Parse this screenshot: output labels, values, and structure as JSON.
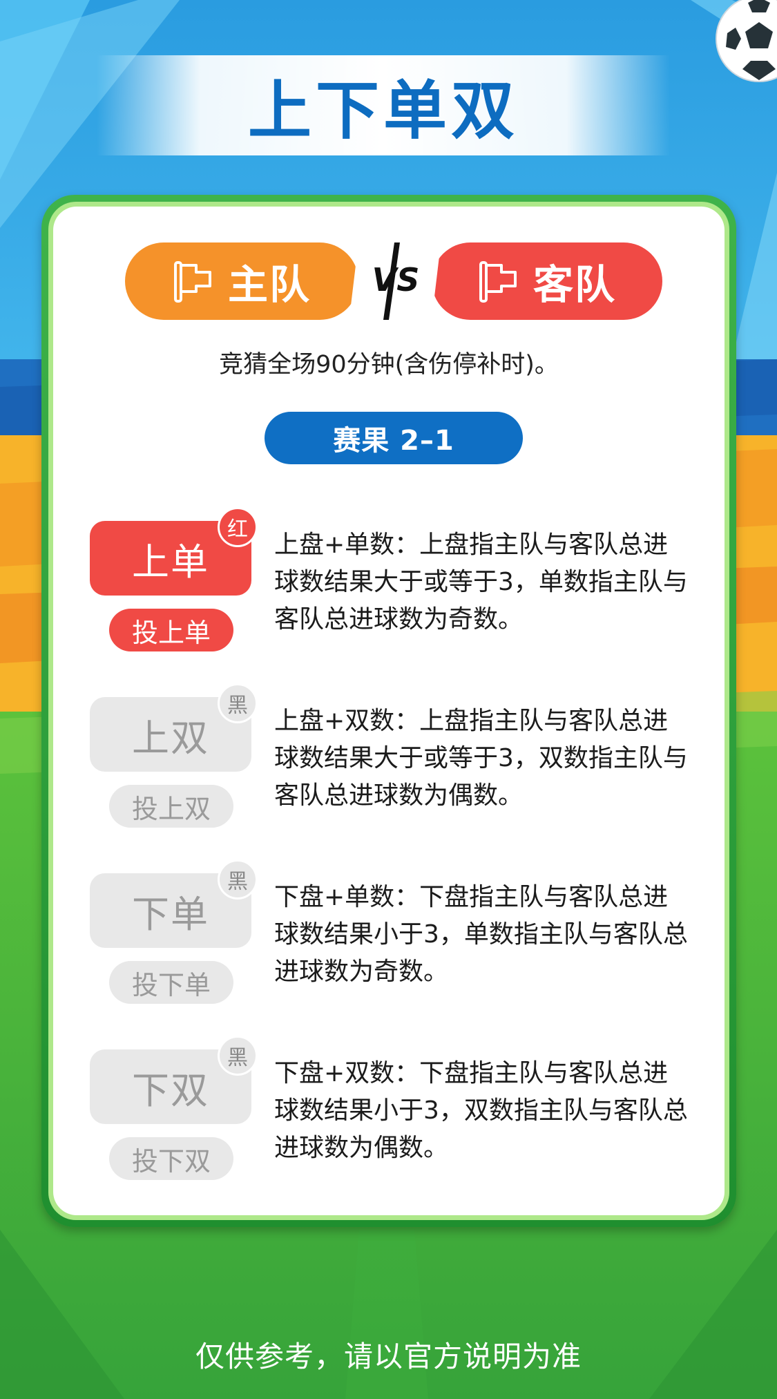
{
  "title": "上下单双",
  "teams": {
    "home": "主队",
    "away": "客队",
    "vs": "VS"
  },
  "rule": "竞猜全场90分钟(含伤停补时)。",
  "result": "赛果 2–1",
  "options": [
    {
      "label": "上单",
      "badge": "红",
      "bet": "投上单",
      "state": "active",
      "description": "上盘+单数：上盘指主队与客队总进球数结果大于或等于3，单数指主队与客队总进球数为奇数。"
    },
    {
      "label": "上双",
      "badge": "黑",
      "bet": "投上双",
      "state": "inactive",
      "description": "上盘+双数：上盘指主队与客队总进球数结果大于或等于3，双数指主队与客队总进球数为偶数。"
    },
    {
      "label": "下单",
      "badge": "黑",
      "bet": "投下单",
      "state": "inactive",
      "description": "下盘+单数：下盘指主队与客队总进球数结果小于3，单数指主队与客队总进球数为奇数。"
    },
    {
      "label": "下双",
      "badge": "黑",
      "bet": "投下双",
      "state": "inactive",
      "description": "下盘+双数：下盘指主队与客队总进球数结果小于3，双数指主队与客队总进球数为偶数。"
    }
  ],
  "footer": "仅供参考，请以官方说明为准",
  "colors": {
    "title_blue": "#0d6cc0",
    "home_orange": "#f5922a",
    "away_red": "#f04a45",
    "result_blue": "#0f6fc4",
    "card_green": "#3fb34a",
    "inactive_gray": "#e8e8e8"
  },
  "icons": [
    "flag-icon",
    "vs-icon",
    "soccer-ball-icon"
  ]
}
